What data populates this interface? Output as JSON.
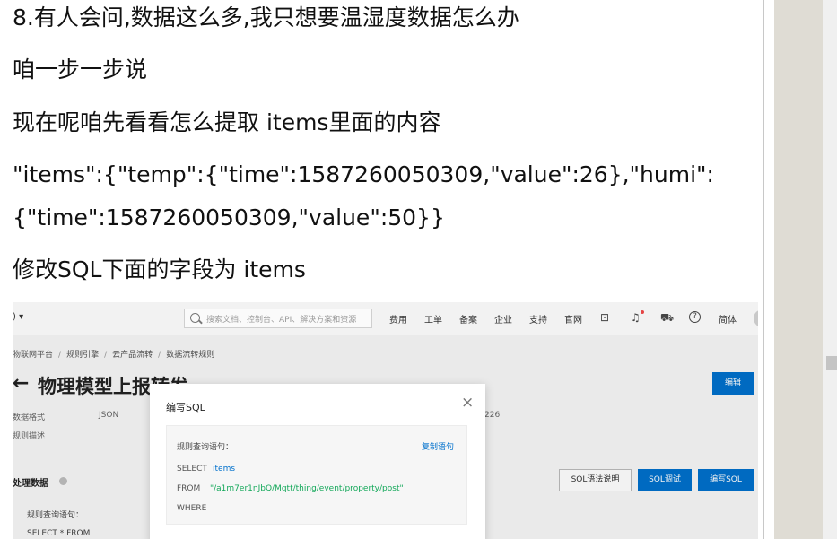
{
  "article": {
    "paragraphs": [
      "8.有人会问,数据这么多,我只想要温湿度数据怎么办",
      "咱一步一步说",
      "现在呢咱先看看怎么提取 items里面的内容",
      "\"items\":{\"temp\":{\"time\":1587260050309,\"value\":26},\"humi\":",
      "{\"time\":1587260050309,\"value\":50}}",
      "修改SQL下面的字段为 items"
    ]
  },
  "console": {
    "topbar": {
      "dropdown": ") ▾",
      "search_placeholder": "搜索文档、控制台、API、解决方案和资源",
      "nav": [
        "费用",
        "工单",
        "备案",
        "企业",
        "支持",
        "官网",
        "简体"
      ],
      "icons": [
        "terminal-icon",
        "bell-icon",
        "cart-icon",
        "help-icon"
      ],
      "help_glyph": "?",
      "bell_dot_color": "#e54545"
    },
    "breadcrumb": [
      "物联网平台",
      "规则引擎",
      "云产品流转",
      "数据流转规则"
    ],
    "breadcrumb_sep": "/",
    "title_arrow": "←",
    "page_title": "物理模型上报转发",
    "edit_button": "编辑",
    "meta": {
      "format_label": "数据格式",
      "format_value": "JSON",
      "desc_label": "规则描述",
      "partial_value": "226"
    },
    "section_title": "处理数据",
    "buttons": {
      "sql_help": "SQL语法说明",
      "sql_debug": "SQL调试",
      "write_sql": "编写SQL"
    },
    "rule_label": "规则查询语句：",
    "rule_statement": "SELECT * FROM",
    "accent_color": "#0070cc",
    "modal": {
      "title": "编写SQL",
      "close": "×",
      "query_label": "规则查询语句：",
      "copy_link": "复制语句",
      "select_kw": "SELECT",
      "select_val": "items",
      "from_kw": "FROM",
      "from_val": "\"/a1m7er1nJbQ/Mqtt/thing/event/property/post\"",
      "where_kw": "WHERE",
      "from_color": "#14a85a"
    }
  }
}
